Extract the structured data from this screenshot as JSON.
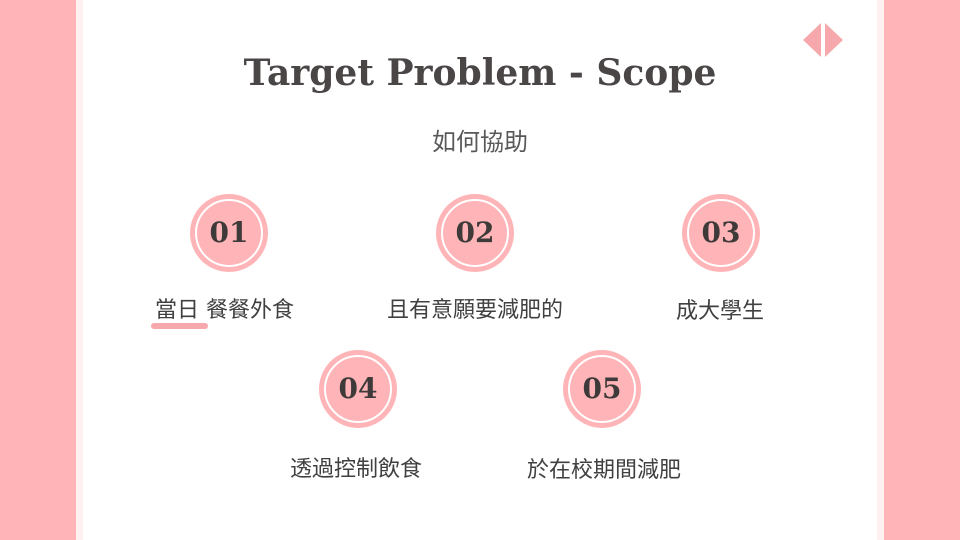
{
  "slide": {
    "title": "Target Problem - Scope",
    "subtitle": "如何協助"
  },
  "items": [
    {
      "number": "01",
      "label": "當日  餐餐外食"
    },
    {
      "number": "02",
      "label": "且有意願要減肥的"
    },
    {
      "number": "03",
      "label": "成大學生"
    },
    {
      "number": "04",
      "label": "透過控制飲食"
    },
    {
      "number": "05",
      "label": "於在校期間減肥"
    }
  ],
  "icons": {
    "nav": "nav-arrows-icon"
  },
  "colors": {
    "accent": "#ffb5b8",
    "strip": "#fff1f0",
    "title": "#4a4646",
    "text": "#404040"
  }
}
